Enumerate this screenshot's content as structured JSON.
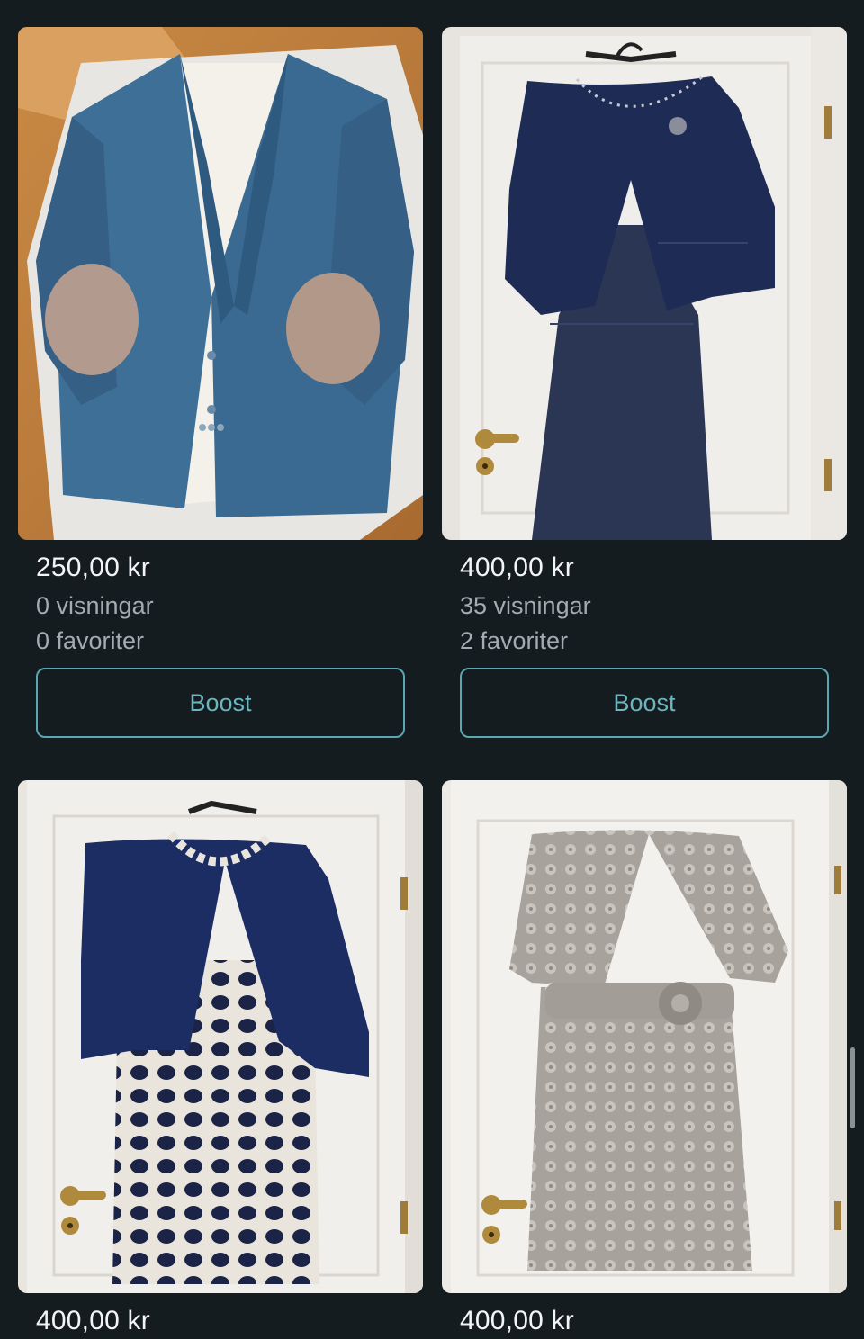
{
  "listings": [
    {
      "price": "250,00 kr",
      "views": "0 visningar",
      "favorites": "0 favoriter",
      "action_label": "Boost",
      "image": "blue-linen-blazer-with-elbow-patches"
    },
    {
      "price": "400,00 kr",
      "views": "35 visningar",
      "favorites": "2 favoriter",
      "action_label": "Boost",
      "image": "navy-lace-dress-with-bolero-jacket"
    },
    {
      "price": "400,00 kr",
      "image": "navy-white-pattern-dress-with-jacket"
    },
    {
      "price": "400,00 kr",
      "image": "grey-lace-dress-with-bolero"
    }
  ],
  "colors": {
    "background": "#151c1f",
    "price_text": "#f2f4f5",
    "secondary_text": "#a3acb0",
    "accent": "#5aa7b1"
  }
}
